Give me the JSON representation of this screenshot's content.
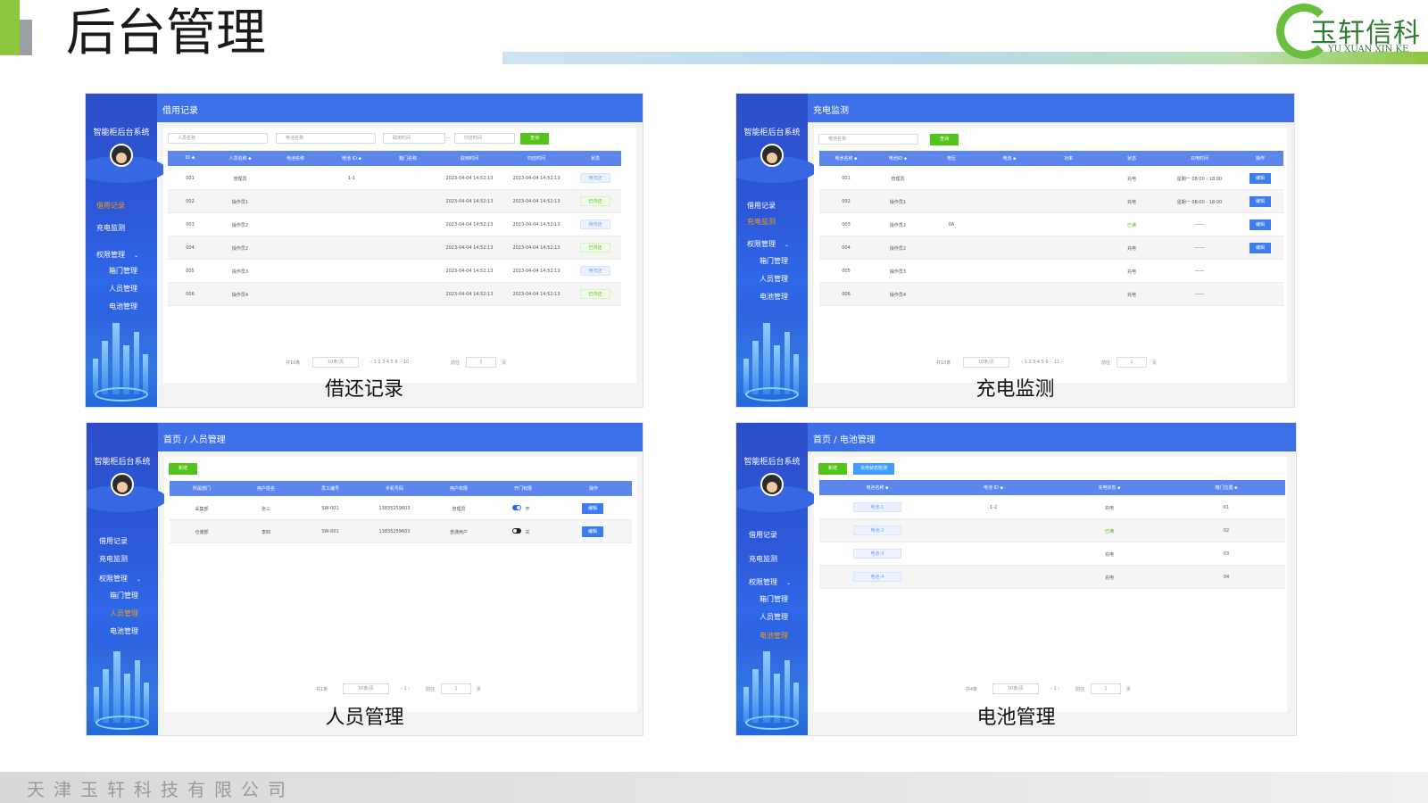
{
  "slide": {
    "title": "后台管理",
    "logo_text": "玉轩信科",
    "logo_sub": "YU XUAN XIN KE",
    "footer": "天津玉轩科技有限公司",
    "brand_green": "#8dc63f",
    "accent_blue": "#3c6fe8"
  },
  "sidebar": {
    "title": "智能柜后台系统",
    "items": [
      "借用记录",
      "充电监测",
      "权限管理",
      "箱门管理",
      "人员管理",
      "电池管理"
    ]
  },
  "panel1": {
    "caption": "借还记录",
    "header": "借用记录",
    "filters": [
      "人员名称",
      "电池名称",
      "取用时间",
      "归还时间"
    ],
    "filter_sep": "—",
    "query_button": "查询",
    "columns": [
      "ID ⬥",
      "人员名称 ⬥",
      "电池名称",
      "电池 ID ⬥",
      "箱门名称",
      "取用时间",
      "归还时间",
      "状态"
    ],
    "rows": [
      [
        "001",
        "管理员",
        "",
        "1-1",
        "",
        "2023-04-04 14:52:13",
        "2023-04-04 14:52:13",
        "待归还"
      ],
      [
        "002",
        "操作员1",
        "",
        "",
        "",
        "2023-04-04 14:52:13",
        "2023-04-04 14:52:13",
        "已归还"
      ],
      [
        "003",
        "操作员2",
        "",
        "",
        "",
        "2023-04-04 14:52:13",
        "2023-04-04 14:52:13",
        "待归还"
      ],
      [
        "004",
        "操作员2",
        "",
        "",
        "",
        "2023-04-04 14:52:13",
        "2023-04-04 14:52:13",
        "已归还"
      ],
      [
        "005",
        "操作员3",
        "",
        "",
        "",
        "2023-04-04 14:52:13",
        "2023-04-04 14:52:13",
        "待归还"
      ],
      [
        "006",
        "操作员4",
        "",
        "",
        "",
        "2023-04-04 14:52:13",
        "2023-04-04 14:52:13",
        "已归还"
      ]
    ],
    "pager": {
      "total": "共10条",
      "size": "10条/页",
      "pages": "‹ 1 2 3 4 5 6 ···10 ›",
      "goto": "前往",
      "page": "1",
      "unit": "页"
    }
  },
  "panel2": {
    "caption": "充电监测",
    "header": "充电监测",
    "filters": [
      "电池名称"
    ],
    "query_button": "查询",
    "columns": [
      "电池名称 ⬥",
      "电池ID ⬥",
      "电压",
      "电流 ⬥",
      "功率",
      "状态",
      "充电时间",
      "操作"
    ],
    "rows": [
      [
        "001",
        "管理员",
        "",
        "",
        "",
        "充电",
        "星期一 08:00 - 18:00",
        "编辑"
      ],
      [
        "002",
        "操作员1",
        "",
        "",
        "",
        "充电",
        "星期一 08:00 - 18:00",
        "编辑"
      ],
      [
        "003",
        "操作员2",
        "0A",
        "",
        "",
        "已满",
        "——",
        "编辑"
      ],
      [
        "004",
        "操作员2",
        "",
        "",
        "",
        "充电",
        "——",
        "编辑"
      ],
      [
        "005",
        "操作员3",
        "",
        "",
        "",
        "充电",
        "——",
        ""
      ],
      [
        "006",
        "操作员4",
        "",
        "",
        "",
        "充电",
        "——",
        ""
      ]
    ],
    "pager": {
      "total": "共10条",
      "size": "10条/页",
      "pages": "‹ 1 2 3 4 5 6 ···11 ›",
      "goto": "前往",
      "page": "1",
      "unit": "页"
    }
  },
  "panel3": {
    "caption": "人员管理",
    "header": "首页 / 人员管理",
    "add_button": "新增",
    "columns": [
      "所属部门",
      "用户姓名",
      "员工编号",
      "手机号码",
      "用户权限",
      "开门权限",
      "操作"
    ],
    "rows": [
      [
        "采集部",
        "张三",
        "SW-001",
        "13835259603",
        "管理员",
        "on",
        "编辑"
      ],
      [
        "仓储部",
        "李四",
        "SW-001",
        "13835259603",
        "普通用户",
        "off",
        "编辑"
      ]
    ],
    "toggle_labels": [
      "开",
      "关"
    ],
    "pager": {
      "total": "共1条",
      "size": "10条/页",
      "pages": "‹ 1 ›",
      "goto": "前往",
      "page": "1",
      "unit": "页"
    }
  },
  "panel4": {
    "caption": "电池管理",
    "header": "首页 / 电池管理",
    "add_button": "新增",
    "status_button": "充电状态检测",
    "columns": [
      "电池名称 ⬥",
      "电池 ID ⬥",
      "充电状态 ⬥",
      "箱门位置 ⬥"
    ],
    "rows": [
      [
        "电池-1",
        "1-2",
        "充电",
        "01"
      ],
      [
        "电池-2",
        "",
        "已满",
        "02"
      ],
      [
        "电池-3",
        "",
        "充电",
        "03"
      ],
      [
        "电池-4",
        "",
        "充电",
        "04"
      ]
    ],
    "pager": {
      "total": "共4条",
      "size": "10条/页",
      "pages": "‹ 1 ›",
      "goto": "前往",
      "page": "1",
      "unit": "页"
    }
  }
}
